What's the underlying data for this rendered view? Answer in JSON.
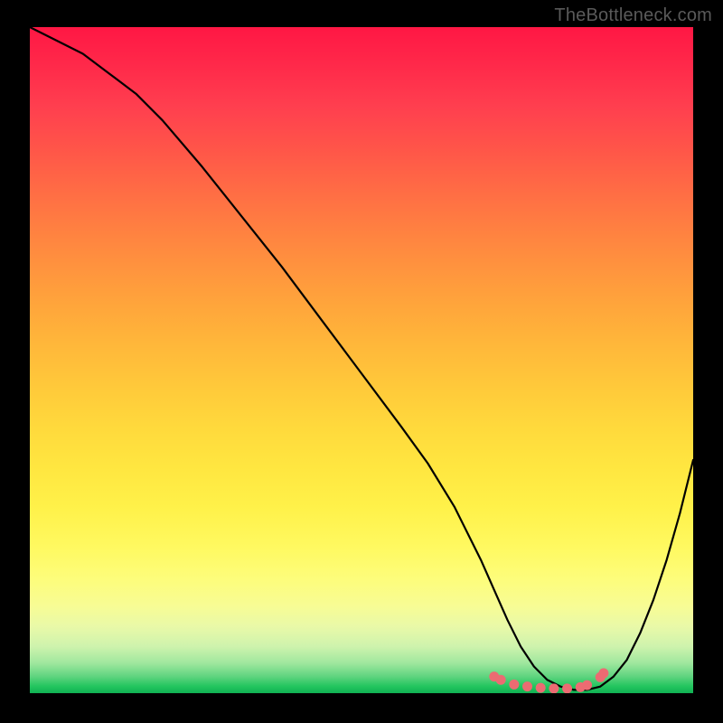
{
  "watermark": "TheBottleneck.com",
  "chart_data": {
    "type": "line",
    "title": "",
    "xlabel": "",
    "ylabel": "",
    "xlim": [
      0,
      100
    ],
    "ylim": [
      0,
      100
    ],
    "legend": false,
    "grid": false,
    "background": "rainbow-gradient-vertical (red→orange→yellow→green)",
    "series": [
      {
        "name": "curve",
        "color": "#000000",
        "x": [
          0,
          4,
          8,
          12,
          16,
          20,
          26,
          32,
          38,
          44,
          50,
          56,
          60,
          64,
          68,
          70,
          72,
          74,
          76,
          78,
          80,
          82,
          84,
          86,
          88,
          90,
          92,
          94,
          96,
          98,
          100
        ],
        "values": [
          100,
          98,
          96,
          93,
          90,
          86,
          79,
          71.5,
          64,
          56,
          48,
          40,
          34.5,
          28,
          20,
          15.5,
          11,
          7,
          4,
          2,
          1,
          0.5,
          0.5,
          1,
          2.5,
          5,
          9,
          14,
          20,
          27,
          35
        ]
      }
    ],
    "markers": [
      {
        "name": "highlight-dots",
        "color": "#ec6b72",
        "x": [
          70,
          71,
          73,
          75,
          77,
          79,
          81,
          83,
          84,
          86,
          86.5
        ],
        "values": [
          2.5,
          2,
          1.3,
          1,
          0.8,
          0.7,
          0.7,
          0.9,
          1.2,
          2.4,
          3.0
        ]
      }
    ]
  }
}
